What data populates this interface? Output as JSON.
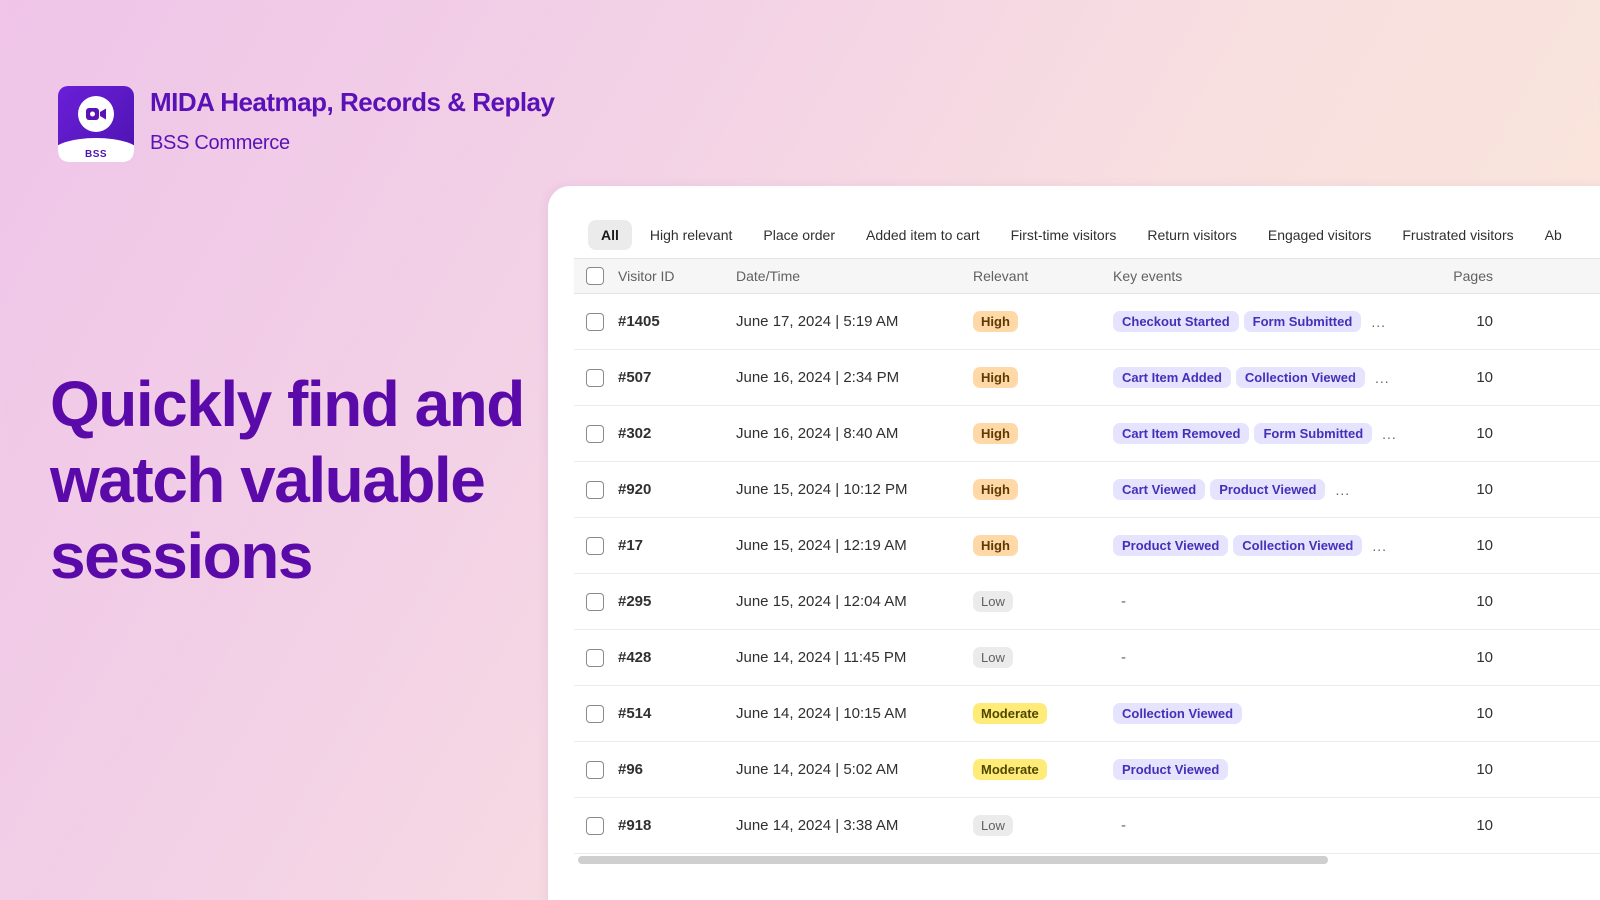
{
  "brand": {
    "app_name": "MIDA Heatmap, Records & Replay",
    "vendor": "BSS Commerce",
    "logo_text": "BSS",
    "logo_icon": "video-camera-icon",
    "primary_color": "#5a0aa8"
  },
  "headline": "Quickly find and watch valuable sessions",
  "tabs": [
    {
      "label": "All",
      "active": true
    },
    {
      "label": "High relevant"
    },
    {
      "label": "Place order"
    },
    {
      "label": "Added item to cart"
    },
    {
      "label": "First-time visitors"
    },
    {
      "label": "Return visitors"
    },
    {
      "label": "Engaged visitors"
    },
    {
      "label": "Frustrated visitors"
    },
    {
      "label": "Ab"
    }
  ],
  "table": {
    "headers": {
      "visitor_id": "Visitor ID",
      "datetime": "Date/Time",
      "relevant": "Relevant",
      "key_events": "Key events",
      "pages": "Pages"
    },
    "rows": [
      {
        "id": "#1405",
        "datetime": "June 17, 2024 | 5:19 AM",
        "relevant": "High",
        "events": [
          "Checkout Started",
          "Form Submitted"
        ],
        "more": true,
        "pages": "10"
      },
      {
        "id": "#507",
        "datetime": "June 16, 2024 | 2:34 PM",
        "relevant": "High",
        "events": [
          "Cart Item Added",
          "Collection Viewed"
        ],
        "more": true,
        "pages": "10"
      },
      {
        "id": "#302",
        "datetime": "June 16, 2024 | 8:40 AM",
        "relevant": "High",
        "events": [
          "Cart Item Removed",
          "Form Submitted"
        ],
        "more": true,
        "pages": "10"
      },
      {
        "id": "#920",
        "datetime": "June 15, 2024 | 10:12 PM",
        "relevant": "High",
        "events": [
          "Cart Viewed",
          "Product Viewed"
        ],
        "more": true,
        "pages": "10"
      },
      {
        "id": "#17",
        "datetime": "June 15, 2024 | 12:19 AM",
        "relevant": "High",
        "events": [
          "Product Viewed",
          "Collection Viewed"
        ],
        "more": true,
        "pages": "10"
      },
      {
        "id": "#295",
        "datetime": "June 15, 2024 | 12:04 AM",
        "relevant": "Low",
        "events": [],
        "more": false,
        "pages": "10"
      },
      {
        "id": "#428",
        "datetime": "June 14, 2024 | 11:45 PM",
        "relevant": "Low",
        "events": [],
        "more": false,
        "pages": "10"
      },
      {
        "id": "#514",
        "datetime": "June 14, 2024 | 10:15 AM",
        "relevant": "Moderate",
        "events": [
          "Collection Viewed"
        ],
        "more": false,
        "pages": "10"
      },
      {
        "id": "#96",
        "datetime": "June 14, 2024 | 5:02 AM",
        "relevant": "Moderate",
        "events": [
          "Product Viewed"
        ],
        "more": false,
        "pages": "10"
      },
      {
        "id": "#918",
        "datetime": "June 14, 2024 | 3:38 AM",
        "relevant": "Low",
        "events": [],
        "more": false,
        "pages": "10"
      }
    ],
    "empty_events": "-",
    "more_label": "..."
  }
}
